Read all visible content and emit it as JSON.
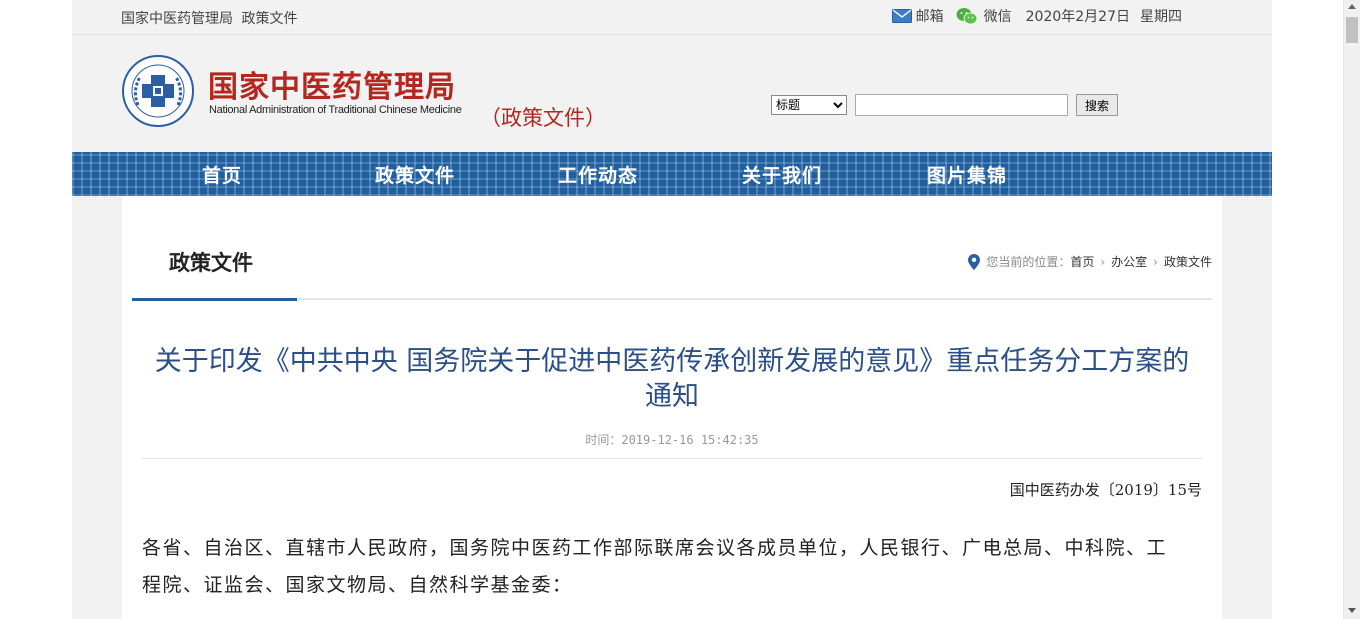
{
  "topbar": {
    "site_name": "国家中医药管理局",
    "section": "政策文件",
    "mail_label": "邮箱",
    "wechat_label": "微信",
    "date": "2020年2月27日",
    "weekday": "星期四"
  },
  "header": {
    "logo_cn": "国家中医药管理局",
    "logo_en": "National Administration of Traditional Chinese Medicine",
    "logo_subtitle": "（政策文件）",
    "emblem_text": "中国·国家中医药管理局"
  },
  "search": {
    "field_selected": "标题",
    "input_value": "",
    "button_label": "搜索"
  },
  "nav": {
    "items": [
      {
        "label": "首页"
      },
      {
        "label": "政策文件"
      },
      {
        "label": "工作动态"
      },
      {
        "label": "关于我们"
      },
      {
        "label": "图片集锦"
      }
    ]
  },
  "main": {
    "section_title": "政策文件",
    "location": {
      "label": "您当前的位置：",
      "items": [
        "首页",
        "办公室",
        "政策文件"
      ]
    },
    "article": {
      "title": "关于印发《中共中央 国务院关于促进中医药传承创新发展的意见》重点任务分工方案的通知",
      "time_label": "时间：",
      "time_value": "2019-12-16 15:42:35",
      "doc_number": "国中医药办发〔2019〕15号",
      "body": "各省、自治区、直辖市人民政府，国务院中医药工作部际联席会议各成员单位，人民银行、广电总局、中科院、工程院、证监会、国家文物局、自然科学基金委："
    }
  },
  "colors": {
    "brand_red": "#b5261e",
    "nav_blue": "#1f5fa0",
    "title_blue": "#2b4f88"
  }
}
